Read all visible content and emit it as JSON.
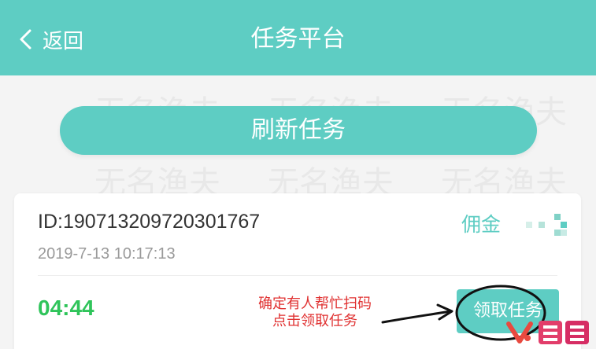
{
  "header": {
    "back_label": "返回",
    "title": "任务平台"
  },
  "refresh_label": "刷新任务",
  "task": {
    "id": "ID:190713209720301767",
    "time": "2019-7-13 10:17:13",
    "commission_label": "佣金",
    "countdown": "04:44",
    "claim_label": "领取任务"
  },
  "annotation": {
    "line1": "确定有人帮忙扫码",
    "line2": "点击领取任务"
  },
  "watermark": {
    "text": "无名渔夫"
  },
  "colors": {
    "accent": "#5ecdc3",
    "countdown": "#2fc45a",
    "annotation": "#e03131"
  },
  "icons": {
    "back": "chevron-left-icon"
  }
}
